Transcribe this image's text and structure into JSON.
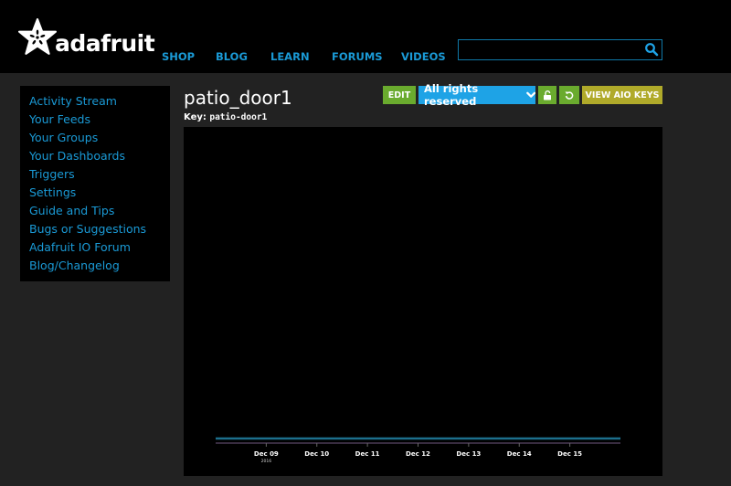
{
  "header": {
    "logo_text": "adafruit",
    "nav": [
      "SHOP",
      "BLOG",
      "LEARN",
      "FORUMS",
      "VIDEOS"
    ],
    "search": {
      "value": "",
      "placeholder": ""
    }
  },
  "sidebar": {
    "items": [
      {
        "label": "Activity Stream"
      },
      {
        "label": "Your Feeds"
      },
      {
        "label": "Your Groups"
      },
      {
        "label": "Your Dashboards"
      },
      {
        "label": "Triggers"
      },
      {
        "label": "Settings"
      },
      {
        "label": "Guide and Tips"
      },
      {
        "label": "Bugs or Suggestions"
      },
      {
        "label": "Adafruit IO Forum"
      },
      {
        "label": "Blog/Changelog"
      }
    ]
  },
  "feed": {
    "title": "patio_door1",
    "key_label": "Key:",
    "key_value": "patio-door1"
  },
  "toolbar": {
    "edit_label": "EDIT",
    "rights_label": "All rights reserved",
    "lock_icon": "unlock-icon",
    "reset_icon": "refresh-icon",
    "keys_label": "VIEW AIO KEYS"
  },
  "colors": {
    "link": "#1a9ad6",
    "edit": "#6aab2e",
    "rights": "#1ea3e6",
    "keys": "#b0aa2a",
    "series": "#1c6f8c"
  },
  "chart_data": {
    "type": "line",
    "title": "",
    "xlabel": "",
    "ylabel": "",
    "x_ticks": [
      "Dec 09",
      "Dec 10",
      "Dec 11",
      "Dec 12",
      "Dec 13",
      "Dec 14",
      "Dec 15"
    ],
    "x_year_label": "2016",
    "series": [
      {
        "name": "patio_door1",
        "x": [
          "Dec 08",
          "Dec 09",
          "Dec 10",
          "Dec 11",
          "Dec 12",
          "Dec 13",
          "Dec 14",
          "Dec 15",
          "Dec 16"
        ],
        "values": [
          0,
          0,
          0,
          0,
          0,
          0,
          0,
          0,
          0
        ]
      }
    ],
    "ylim": [
      0,
      1
    ],
    "grid": false,
    "legend": "none"
  }
}
